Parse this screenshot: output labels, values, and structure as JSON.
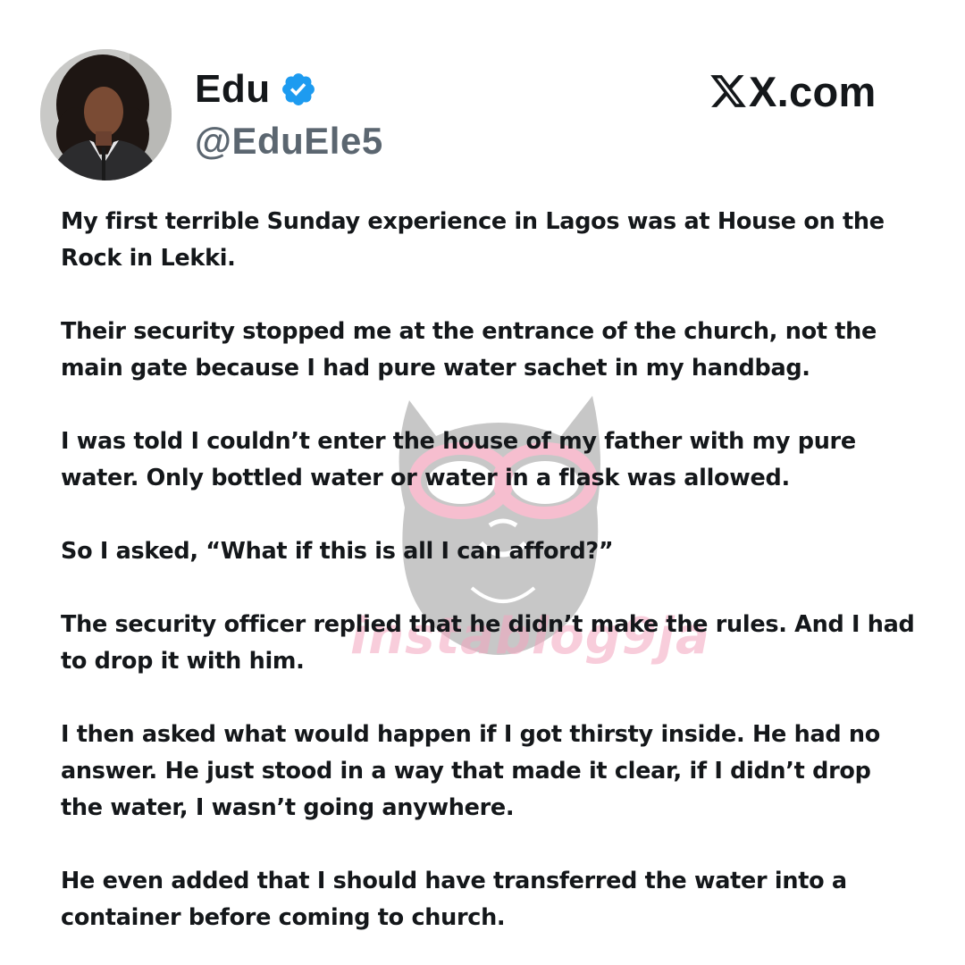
{
  "brand": {
    "site": "X.com",
    "logo_icon": "x-logo-icon"
  },
  "author": {
    "display_name": "Edu",
    "handle": "@EduEle5",
    "verified": true,
    "verified_color": "#1d9bf0"
  },
  "tweet": {
    "paragraphs": [
      "My first terrible Sunday experience in Lagos was at House on the Rock in Lekki.",
      "Their security stopped me at the entrance of the church, not the main gate because I had pure water sachet in my handbag.",
      "I was told I couldn’t enter the house of my father with my pure water. Only bottled water or water in a flask was allowed.",
      "So I asked, “What if this is all I can afford?”",
      "The security officer replied that he didn’t make the rules. And I had to drop it with him.",
      "I then asked what would happen if I got thirsty inside. He had no answer. He just stood in a way that made it clear, if I didn’t drop the water, I wasn’t going anywhere.",
      "He even added that I should have transferred the water into a container before coming to church."
    ]
  },
  "watermark": {
    "text": "instablog9ja",
    "color": "#f3a6bf"
  }
}
